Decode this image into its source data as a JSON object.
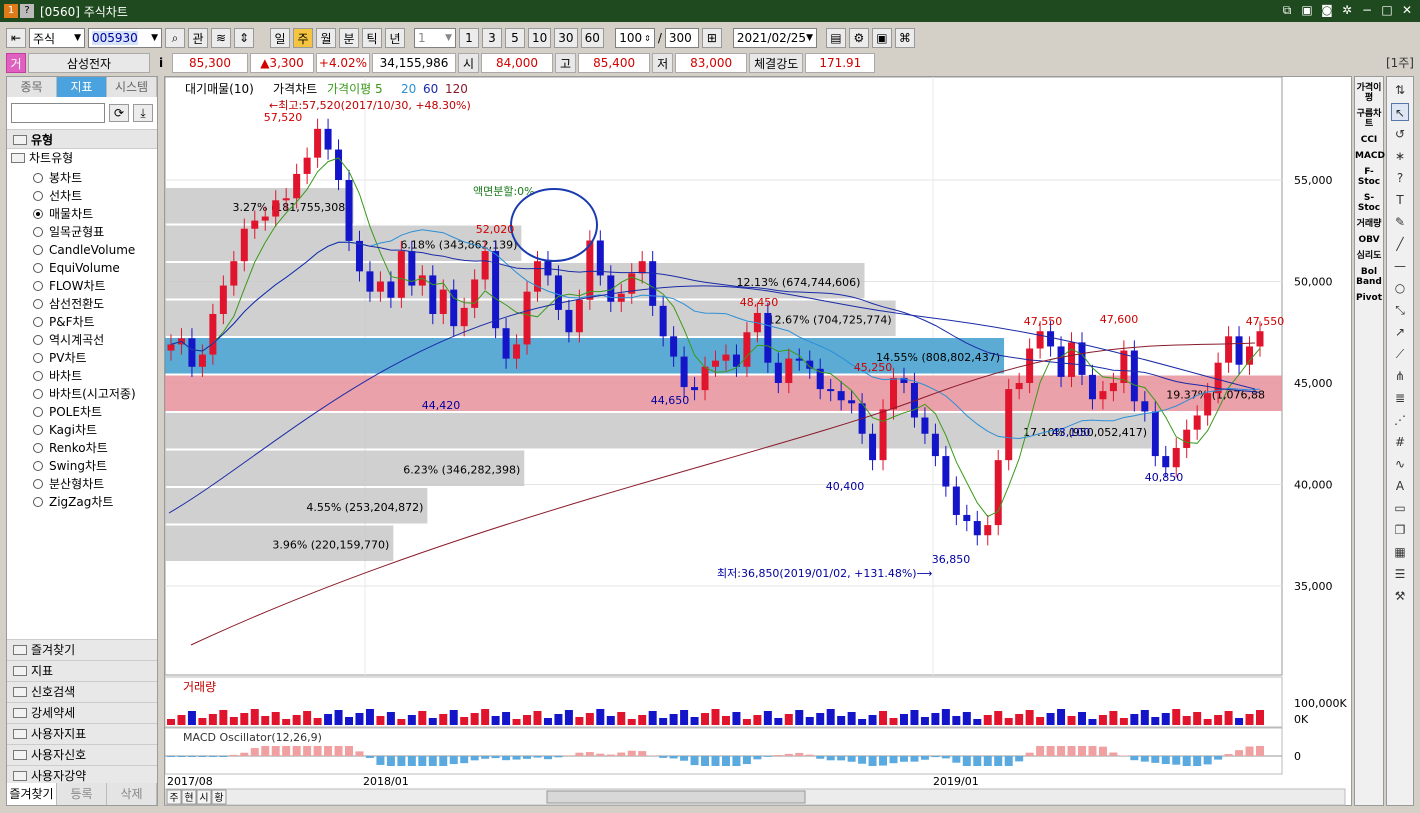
{
  "window": {
    "badge1": "1",
    "badge2": "?",
    "title": "[0560] 주식차트"
  },
  "toolbar": {
    "market": "주식",
    "code": "005930",
    "btn_gwan": "관",
    "periods": [
      "일",
      "주",
      "월",
      "분",
      "틱",
      "년"
    ],
    "active_period": "주",
    "unit_select": "1",
    "unit_buttons": [
      "1",
      "3",
      "5",
      "10",
      "30",
      "60"
    ],
    "count": "100",
    "total": "300",
    "slash": "/",
    "date": "2021/02/25"
  },
  "quote": {
    "indicator_box": "거",
    "name": "삼성전자",
    "info": "i",
    "price": "85,300",
    "change": "▲3,300",
    "rate": "+4.02%",
    "volume": "34,155,986",
    "open_label": "시",
    "open": "84,000",
    "high_label": "고",
    "high": "85,400",
    "low_label": "저",
    "low": "83,000",
    "strength_label": "체결강도",
    "strength": "171.91",
    "week_indicator": "[1주]"
  },
  "left_panel": {
    "tabs": [
      "종목",
      "지표",
      "시스템"
    ],
    "active_tab": "지표",
    "section": "유형",
    "chart_type_header": "차트유형",
    "chart_types": [
      "봉차트",
      "선차트",
      "매물차트",
      "일목균형표",
      "CandleVolume",
      "EquiVolume",
      "FLOW차트",
      "삼선전환도",
      "P&F차트",
      "역시계곡선",
      "PV차트",
      "바차트",
      "바차트(시고저종)",
      "POLE차트",
      "Kagi차트",
      "Renko차트",
      "Swing차트",
      "분산형차트",
      "ZigZag차트"
    ],
    "selected_chart_type": "매물차트",
    "bottom_sections": [
      "즐겨찾기",
      "지표",
      "신호검색",
      "강세약세",
      "사용자지표",
      "사용자신호",
      "사용자강약"
    ],
    "bottom_tabs": [
      "즐겨찾기",
      "등록",
      "삭제"
    ]
  },
  "right_toolbar": {
    "indicators": [
      "가격이평",
      "구름차트",
      "CCI",
      "MACD",
      "F-Stoc",
      "S-Stoc",
      "거래량",
      "OBV",
      "심리도",
      "Bol Band",
      "Pivot"
    ]
  },
  "chart": {
    "legend": {
      "vp": "대기매물(10)",
      "price": "가격차트",
      "ma_label": "가격이평",
      "ma": [
        "5",
        "20",
        "60",
        "120"
      ]
    },
    "colors": {
      "up": "#e0142c",
      "down": "#1414c8",
      "ma5": "#3a9a1a",
      "ma20": "#2b8fd6",
      "ma60": "#1a2aa8",
      "ma120": "#8a1a2a"
    },
    "ylabels": [
      "55,000",
      "50,000",
      "45,000",
      "40,000",
      "35,000"
    ],
    "xlabels": [
      "2017/08",
      "2018/01",
      "2019/01"
    ],
    "volume_profile": [
      {
        "label": "3.96% (220,159,770)"
      },
      {
        "label": "4.55% (253,204,872)"
      },
      {
        "label": "6.23% (346,282,398)"
      },
      {
        "label": "17.10% (950,052,417)"
      },
      {
        "label": "19.37% (1,076,88"
      },
      {
        "label": "14.55% (808,802,437)"
      },
      {
        "label": "12.67% (704,725,774)"
      },
      {
        "label": "12.13% (674,744,606)"
      },
      {
        "label": "6.18% (343,862,139)"
      },
      {
        "label": "3.27% (181,755,308)"
      }
    ],
    "annotations": {
      "high": "←최고:57,520(2017/10/30, +48.30%)",
      "low": "최저:36,850(2019/01/02, +131.48%)⟶",
      "split": "액면분할:0%"
    },
    "price_labels": [
      {
        "text": "57,520",
        "color": "red"
      },
      {
        "text": "52,020",
        "color": "red"
      },
      {
        "text": "48,450",
        "color": "red"
      },
      {
        "text": "45,250",
        "color": "red"
      },
      {
        "text": "47,550",
        "color": "red"
      },
      {
        "text": "47,600",
        "color": "red"
      },
      {
        "text": "47,550",
        "color": "red"
      },
      {
        "text": "44,420",
        "color": "blue"
      },
      {
        "text": "44,650",
        "color": "blue"
      },
      {
        "text": "40,400",
        "color": "blue"
      },
      {
        "text": "36,850",
        "color": "blue"
      },
      {
        "text": "43,100",
        "color": "blue"
      },
      {
        "text": "40,850",
        "color": "blue"
      }
    ],
    "volume_title": "거래량",
    "volume_ylabels": [
      "100,000K",
      "0K"
    ],
    "macd_title": "MACD Oscillator(12,26,9)",
    "macd_ylabel": "0",
    "bottom_tabs": [
      "주",
      "현",
      "시",
      "황"
    ]
  },
  "chart_data": {
    "type": "candlestick",
    "title": "",
    "ylim": [
      35000,
      57500
    ],
    "series": [
      {
        "name": "가격차트",
        "values": [
          46900,
          47200,
          45800,
          46400,
          48400,
          49800,
          51000,
          52600,
          53000,
          53200,
          54000,
          54100,
          55300,
          56100,
          57520,
          56500,
          55000,
          52000,
          50500,
          49500,
          50000,
          49200,
          51500,
          49800,
          50300,
          48400,
          49600,
          47800,
          48700,
          50100,
          51500,
          47700,
          46200,
          46900,
          49500,
          51000,
          50300,
          48600,
          47500,
          49100,
          52020,
          50300,
          49000,
          49400,
          50400,
          51000,
          48800,
          47300,
          46300,
          44800,
          44650,
          45800,
          46100,
          46400,
          45800,
          47500,
          48450,
          46000,
          45000,
          46200,
          46100,
          45700,
          44700,
          44600,
          44150,
          44000,
          42500,
          41200,
          43700,
          45250,
          45000,
          43300,
          42500,
          41400,
          39900,
          38500,
          38200,
          37500,
          38000,
          41200,
          44700,
          45000,
          46700,
          47550,
          46800,
          45300,
          47000,
          45400,
          44200,
          44600,
          45000,
          46600,
          44100,
          43600,
          41400,
          40850,
          41800,
          42700,
          43400,
          44500,
          46000,
          47300,
          45900,
          46800,
          47550
        ]
      }
    ],
    "ma_periods": [
      5,
      20,
      60,
      120
    ]
  }
}
